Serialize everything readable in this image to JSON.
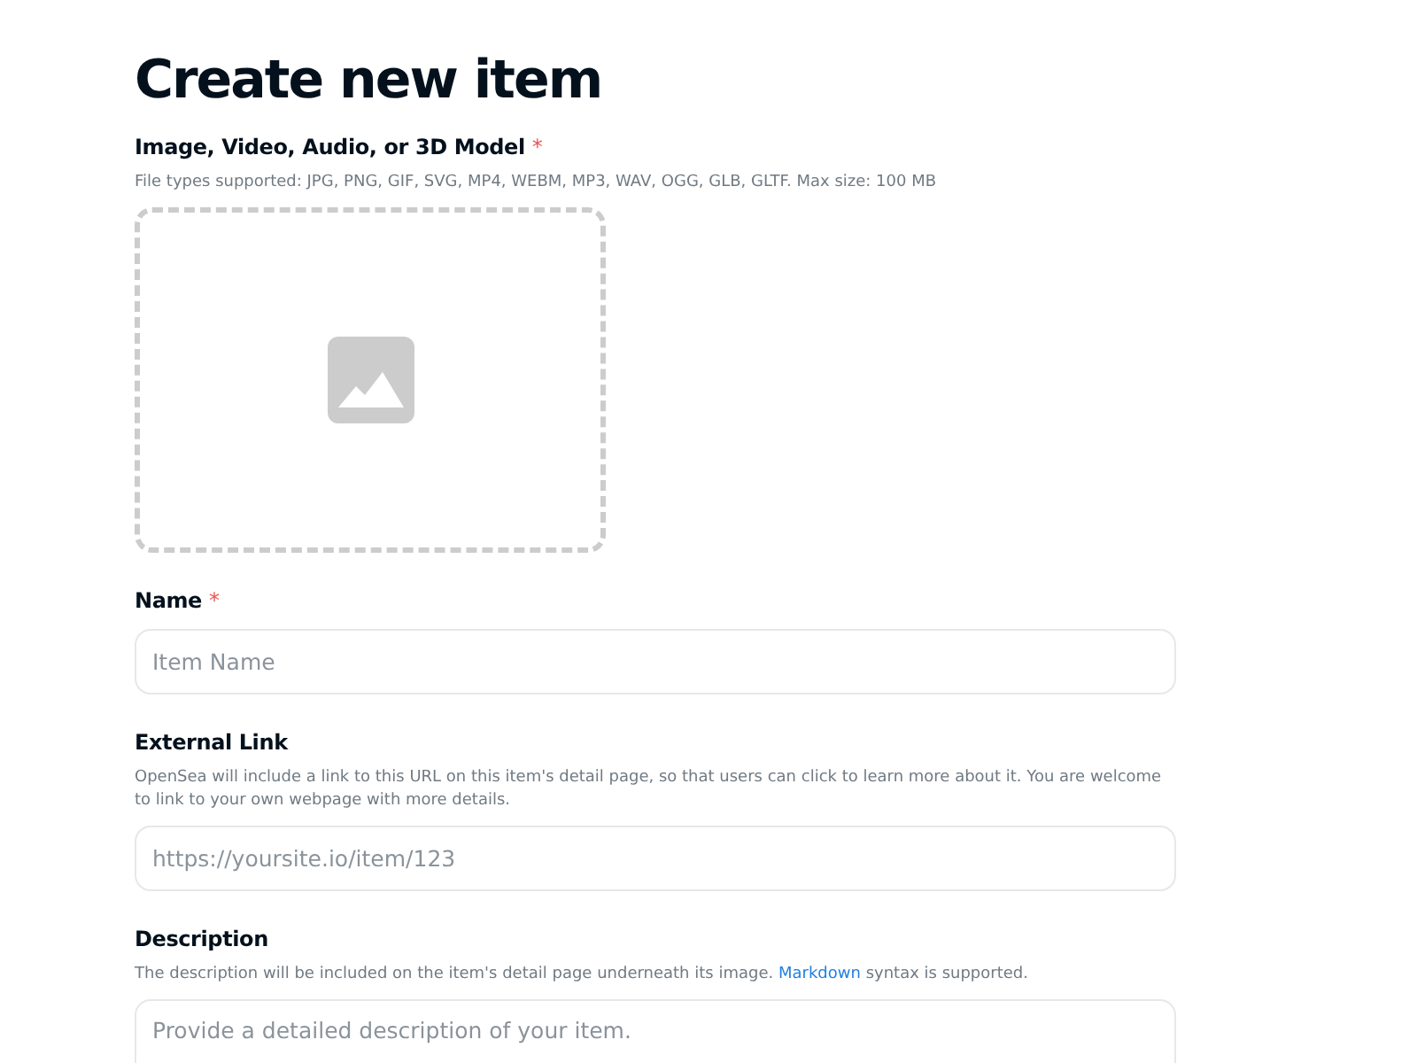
{
  "page": {
    "title": "Create new item"
  },
  "fields": [
    {
      "kind": "upload",
      "label": "Image, Video, Audio, or 3D Model",
      "required_mark": "*",
      "hint": [
        {
          "kind": "text",
          "text": "File types supported: JPG, PNG, GIF, SVG, MP4, WEBM, MP3, WAV, OGG, GLB, GLTF. Max size: 100 MB"
        }
      ]
    },
    {
      "kind": "text",
      "label": "Name",
      "required_mark": "*",
      "placeholder": "Item Name"
    },
    {
      "kind": "text",
      "label": "External Link",
      "hint": [
        {
          "kind": "text",
          "text": "OpenSea will include a link to this URL on this item's detail page, so that users can click to learn more about it. You are welcome to link to your own webpage with more details."
        }
      ],
      "placeholder": "https://yoursite.io/item/123"
    },
    {
      "kind": "textarea",
      "label": "Description",
      "hint": [
        {
          "kind": "text",
          "text": "The description will be included on the item's detail page underneath its image."
        },
        {
          "kind": "link",
          "text": "Markdown"
        },
        {
          "kind": "text",
          "text": "syntax is supported."
        }
      ],
      "placeholder": "Provide a detailed description of your item."
    }
  ]
}
